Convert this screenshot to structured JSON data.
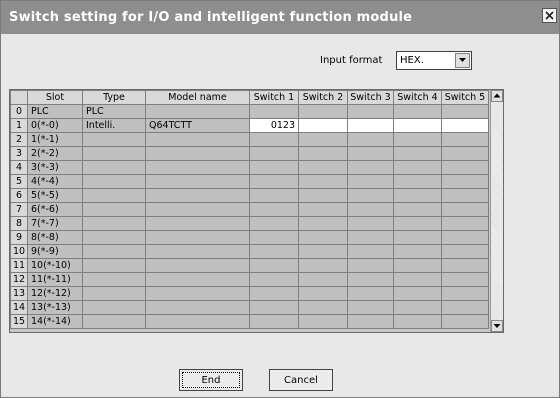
{
  "window": {
    "title": "Switch setting for I/O and intelligent function module"
  },
  "input_format": {
    "label": "Input format",
    "value": "HEX."
  },
  "table": {
    "columns": [
      "Slot",
      "Type",
      "Model name",
      "Switch 1",
      "Switch 2",
      "Switch 3",
      "Switch 4",
      "Switch 5"
    ],
    "rows": [
      {
        "num": "0",
        "slot": "PLC",
        "type": "PLC",
        "model": "",
        "sw": [
          "",
          "",
          "",
          "",
          ""
        ]
      },
      {
        "num": "1",
        "slot": "0(*-0)",
        "type": "Intelli.",
        "model": "Q64TCTT",
        "sw": [
          "0123",
          "",
          "",
          "",
          ""
        ]
      },
      {
        "num": "2",
        "slot": "1(*-1)",
        "type": "",
        "model": "",
        "sw": [
          "",
          "",
          "",
          "",
          ""
        ]
      },
      {
        "num": "3",
        "slot": "2(*-2)",
        "type": "",
        "model": "",
        "sw": [
          "",
          "",
          "",
          "",
          ""
        ]
      },
      {
        "num": "4",
        "slot": "3(*-3)",
        "type": "",
        "model": "",
        "sw": [
          "",
          "",
          "",
          "",
          ""
        ]
      },
      {
        "num": "5",
        "slot": "4(*-4)",
        "type": "",
        "model": "",
        "sw": [
          "",
          "",
          "",
          "",
          ""
        ]
      },
      {
        "num": "6",
        "slot": "5(*-5)",
        "type": "",
        "model": "",
        "sw": [
          "",
          "",
          "",
          "",
          ""
        ]
      },
      {
        "num": "7",
        "slot": "6(*-6)",
        "type": "",
        "model": "",
        "sw": [
          "",
          "",
          "",
          "",
          ""
        ]
      },
      {
        "num": "8",
        "slot": "7(*-7)",
        "type": "",
        "model": "",
        "sw": [
          "",
          "",
          "",
          "",
          ""
        ]
      },
      {
        "num": "9",
        "slot": "8(*-8)",
        "type": "",
        "model": "",
        "sw": [
          "",
          "",
          "",
          "",
          ""
        ]
      },
      {
        "num": "10",
        "slot": "9(*-9)",
        "type": "",
        "model": "",
        "sw": [
          "",
          "",
          "",
          "",
          ""
        ]
      },
      {
        "num": "11",
        "slot": "10(*-10)",
        "type": "",
        "model": "",
        "sw": [
          "",
          "",
          "",
          "",
          ""
        ]
      },
      {
        "num": "12",
        "slot": "11(*-11)",
        "type": "",
        "model": "",
        "sw": [
          "",
          "",
          "",
          "",
          ""
        ]
      },
      {
        "num": "13",
        "slot": "12(*-12)",
        "type": "",
        "model": "",
        "sw": [
          "",
          "",
          "",
          "",
          ""
        ]
      },
      {
        "num": "14",
        "slot": "13(*-13)",
        "type": "",
        "model": "",
        "sw": [
          "",
          "",
          "",
          "",
          ""
        ]
      },
      {
        "num": "15",
        "slot": "14(*-14)",
        "type": "",
        "model": "",
        "sw": [
          "",
          "",
          "",
          "",
          ""
        ]
      }
    ]
  },
  "buttons": {
    "end": "End",
    "cancel": "Cancel"
  },
  "icons": {
    "close": "close-icon",
    "dropdown": "chevron-down-icon",
    "scroll_up": "arrow-up-icon",
    "scroll_down": "arrow-down-icon"
  }
}
